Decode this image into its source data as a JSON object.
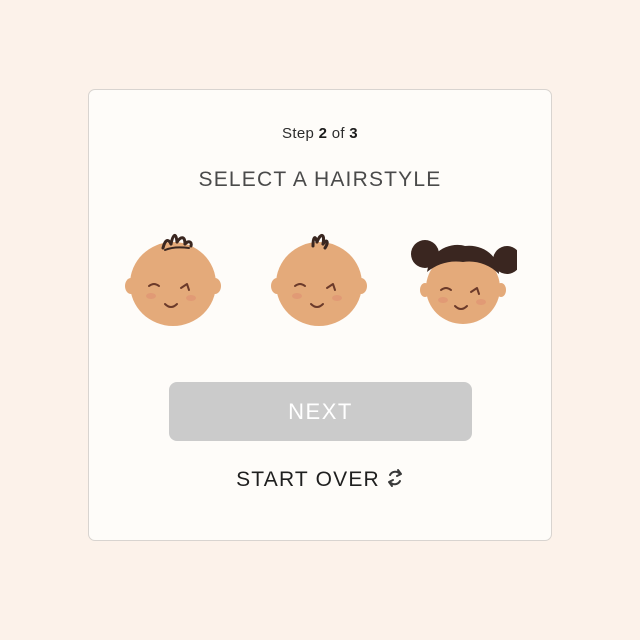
{
  "step": {
    "prefix": "Step",
    "current": "2",
    "separator": "of",
    "total": "3"
  },
  "title": "SELECT A HAIRSTYLE",
  "hairstyles": [
    {
      "icon": "baby-face-short-tuft-icon"
    },
    {
      "icon": "baby-face-single-tuft-icon"
    },
    {
      "icon": "baby-face-two-buns-icon"
    }
  ],
  "buttons": {
    "next_label": "NEXT",
    "start_over_label": "START OVER",
    "start_over_icon": "refresh-icon"
  },
  "colors": {
    "page_background": "#fcf2ea",
    "card_background": "#fefcf9",
    "next_button_disabled": "#cbcbcb",
    "skin": "#e4aa7a",
    "hair": "#3a2620"
  }
}
